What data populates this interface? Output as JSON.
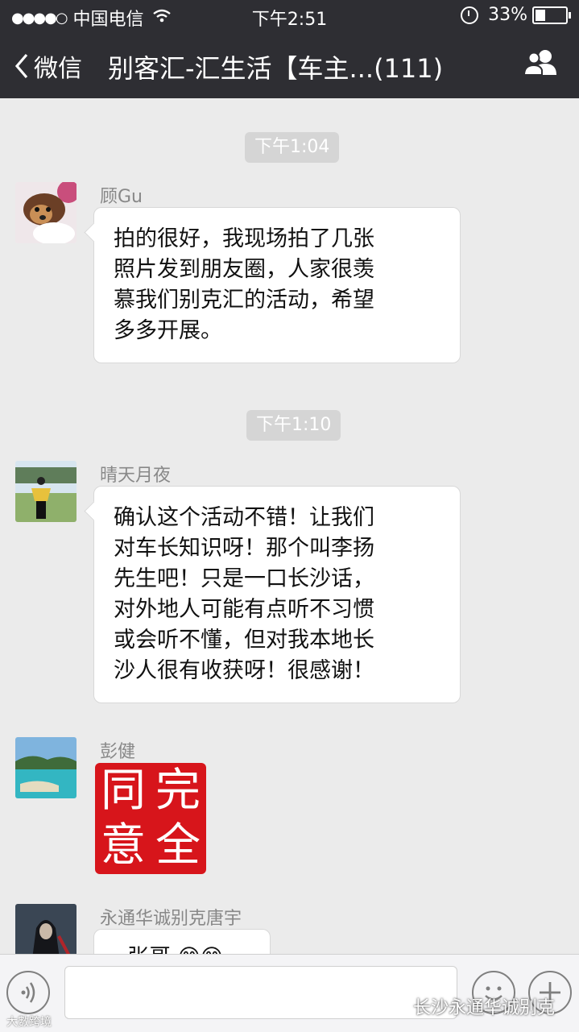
{
  "status_bar": {
    "signal": "●●●●○",
    "carrier": "中国电信",
    "time": "下午2:51",
    "battery_percent": "33%",
    "battery_level": 0.33
  },
  "nav": {
    "back_label": "微信",
    "title": "别客汇-汇生活【车主...(111)"
  },
  "chat": {
    "timestamps": [
      "下午1:04",
      "下午1:10"
    ],
    "messages": [
      {
        "sender": "顾Gu",
        "lines": [
          "拍的很好，我现场拍了几张",
          "照片发到朋友圈，人家很羡",
          "慕我们别克汇的活动，希望",
          "多多开展。"
        ]
      },
      {
        "sender": "晴天月夜",
        "lines": [
          "确认这个活动不错！让我们",
          "对车长知识呀！那个叫李扬",
          "先生吧！只是一口长沙话，",
          "对外地人可能有点听不习惯",
          "或会听不懂，但对我本地长",
          "沙人很有收获呀！很感谢！"
        ]
      },
      {
        "sender": "彭健",
        "sticker_chars": [
          "同",
          "完",
          "意",
          "全"
        ]
      },
      {
        "sender": "永通华诚别克唐宇",
        "partial_text": "· 张哥 😄😄"
      }
    ]
  },
  "watermark": {
    "brand": "长沙永通华诚别克",
    "corner": "大數跨境"
  },
  "colors": {
    "header_bg": "#2e2e33",
    "chat_bg": "#ebebeb",
    "sticker_red": "#d7151b"
  },
  "icons": [
    "chevron-left-icon",
    "wifi-icon",
    "alarm-icon",
    "battery-icon",
    "group-members-icon",
    "voice-icon",
    "emoji-icon",
    "plus-icon",
    "wechat-logo-icon"
  ]
}
